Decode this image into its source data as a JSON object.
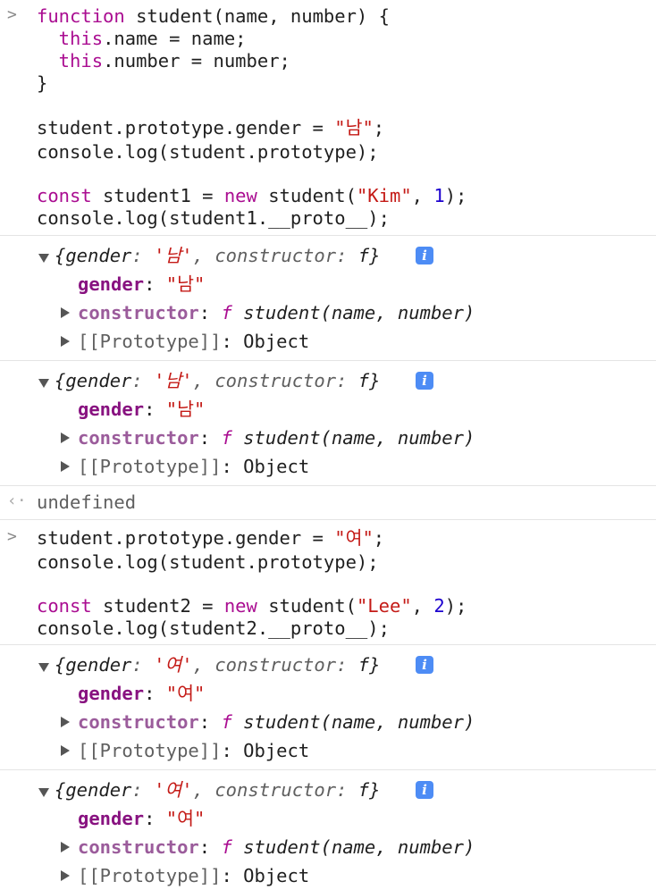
{
  "input1": {
    "lines": [
      [
        "function",
        " student(name, number) {"
      ],
      [
        "  this",
        ".name = name;"
      ],
      [
        "  this",
        ".number = number;"
      ],
      [
        "}",
        ""
      ],
      [
        "student.prototype.gender = ",
        "\"남\"",
        ";"
      ],
      [
        "console.log(student.prototype);"
      ],
      [
        "const",
        " student1 = ",
        "new",
        " student(",
        "\"Kim\"",
        ", ",
        "1",
        ");"
      ],
      [
        "console.log(student1.__proto__);"
      ]
    ]
  },
  "obj1": {
    "summary_key": "{gender",
    "summary_val": "'남'",
    "summary_rest": ", constructor",
    "summary_end": "f}",
    "gender_key": "gender",
    "gender_val": "\"남\"",
    "constructor_key": "constructor",
    "constructor_f": "f",
    "constructor_val": "student(name, number)",
    "proto_key": "[[Prototype]]",
    "proto_val": "Object"
  },
  "obj2": {
    "summary_key": "{gender",
    "summary_val": "'남'",
    "summary_rest": ", constructor",
    "summary_end": "f}",
    "gender_key": "gender",
    "gender_val": "\"남\"",
    "constructor_key": "constructor",
    "constructor_f": "f",
    "constructor_val": "student(name, number)",
    "proto_key": "[[Prototype]]",
    "proto_val": "Object"
  },
  "return1": "undefined",
  "input2": {
    "lines": [
      [
        "student.prototype.gender = ",
        "\"여\"",
        ";"
      ],
      [
        "console.log(student.prototype);"
      ],
      [
        "const",
        " student2 = ",
        "new",
        " student(",
        "\"Lee\"",
        ", ",
        "2",
        ");"
      ],
      [
        "console.log(student2.__proto__);"
      ]
    ]
  },
  "obj3": {
    "summary_key": "{gender",
    "summary_val": "'여'",
    "summary_rest": ", constructor",
    "summary_end": "f}",
    "gender_key": "gender",
    "gender_val": "\"여\"",
    "constructor_key": "constructor",
    "constructor_f": "f",
    "constructor_val": "student(name, number)",
    "proto_key": "[[Prototype]]",
    "proto_val": "Object"
  },
  "obj4": {
    "summary_key": "{gender",
    "summary_val": "'여'",
    "summary_rest": ", constructor",
    "summary_end": "f}",
    "gender_key": "gender",
    "gender_val": "\"여\"",
    "constructor_key": "constructor",
    "constructor_f": "f",
    "constructor_val": "student(name, number)",
    "proto_key": "[[Prototype]]",
    "proto_val": "Object"
  },
  "icons": {
    "prompt": "chevron-right-icon",
    "return": "return-arrow-icon",
    "info": "info-icon"
  }
}
